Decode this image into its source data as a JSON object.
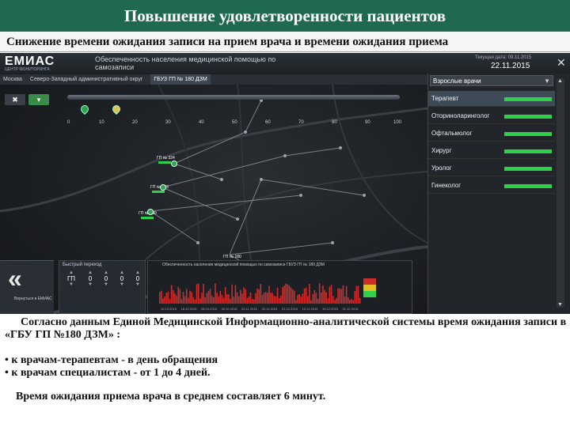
{
  "slide": {
    "title": "Повышение удовлетворенности пациентов",
    "subtitle": "Снижение времени ожидания записи на прием врача и времени ожидания приема"
  },
  "app": {
    "logo": "ЕМИАС",
    "logo_sub": "ЦЕНТР МОНИТОРИНГА",
    "header_title": "Обеспеченность населения медицинской помощью по самозаписи",
    "current_date_label": "Текущая дата: 09.11.2015",
    "date": "22.11.2015",
    "breadcrumb": [
      "Москва",
      "Северо-Западный административный округ",
      "ГБУЗ ГП № 180 ДЗМ"
    ],
    "scale_ticks": [
      "0",
      "10",
      "20",
      "30",
      "40",
      "50",
      "60",
      "70",
      "80",
      "90",
      "100"
    ],
    "marker_labels": [
      "ГП № 324",
      "ГП № 223",
      "ГП № 180",
      "ГП № 180"
    ],
    "panel": {
      "select_label": "Взрослые врачи",
      "doctors": [
        {
          "label": "Терапевт",
          "selected": true
        },
        {
          "label": "Оториноларинголог",
          "selected": false
        },
        {
          "label": "Офтальмолог",
          "selected": false
        },
        {
          "label": "Хирург",
          "selected": false
        },
        {
          "label": "Уролог",
          "selected": false
        },
        {
          "label": "Гинеколог",
          "selected": false
        }
      ]
    },
    "quick_panel": {
      "title": "Быстрый переход",
      "columns": [
        "ГП",
        "0",
        "0",
        "0",
        "0"
      ]
    },
    "left_caption": "Вернуться в ЕМИАС",
    "chart_head": "Обеспеченность населения медицинской помощью по самозаписи ГБУЗ ГП № 180 ДЗМ",
    "chart_x_labels": [
      "10.10.2015",
      "18.10.2015",
      "28.10.2015",
      "30.10.2015",
      "22.11.2015",
      "30.11.2015",
      "01.12.2015",
      "10.12.2015",
      "19.12.2015",
      "31.12.2015"
    ],
    "colors": {
      "green": "#2fd04a",
      "red": "#d02b2b",
      "yellow": "#e0c020",
      "dark_red": "#8a1a1a"
    }
  },
  "body": {
    "para1": "Согласно данным Единой Медицинской Информационно-аналитической системы время ожидания записи в «ГБУ ГП №180 ДЗМ» :",
    "bullet1": "• к врачам-терапевтам - в день обращения",
    "bullet2": "• к врачам специалистам - от 1 до 4 дней.",
    "wait_time": "Время ожидания приема врача в среднем составляет 6 минут."
  }
}
